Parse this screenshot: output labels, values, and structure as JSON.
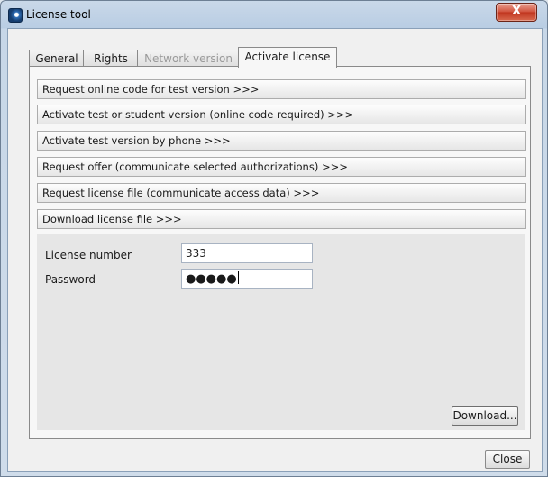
{
  "window": {
    "title": "License tool",
    "close_glyph": "X"
  },
  "tabs": [
    {
      "label": "General",
      "state": "normal"
    },
    {
      "label": "Rights",
      "state": "normal"
    },
    {
      "label": "Network version",
      "state": "disabled"
    },
    {
      "label": "Activate license",
      "state": "active"
    }
  ],
  "actions": [
    {
      "label": "Request online code for test version >>>"
    },
    {
      "label": "Activate test or student version (online code required) >>>"
    },
    {
      "label": "Activate test version by phone >>>"
    },
    {
      "label": "Request offer (communicate selected authorizations) >>>"
    },
    {
      "label": "Request license file (communicate access data) >>>"
    },
    {
      "label": "Download license file >>>"
    }
  ],
  "form": {
    "license_label": "License number",
    "license_value": "333",
    "password_label": "Password",
    "password_masked": "●●●●●",
    "download_label": "Download..."
  },
  "footer": {
    "close_label": "Close"
  },
  "icons": {
    "app": "app-logo-icon",
    "close": "close-icon"
  }
}
